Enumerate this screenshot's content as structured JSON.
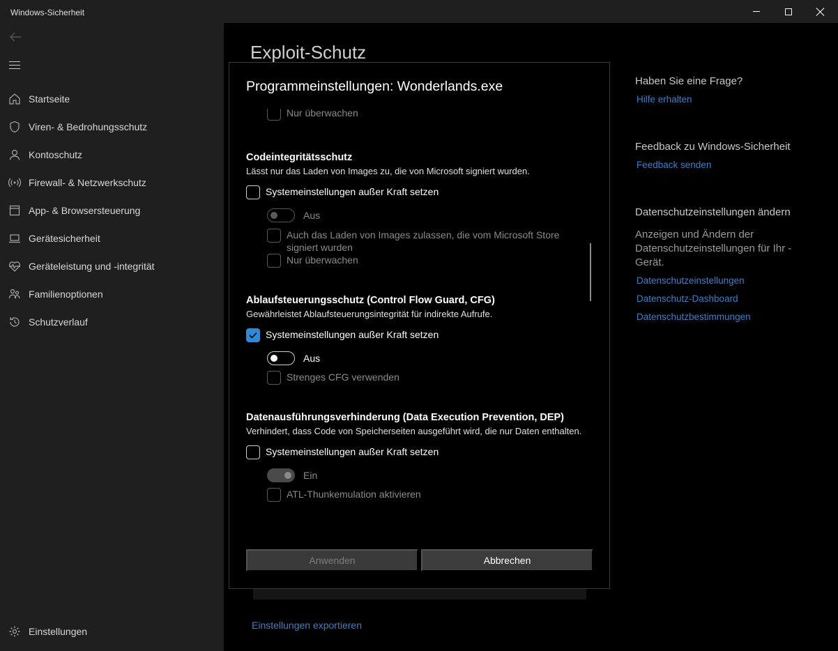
{
  "window": {
    "title": "Windows-Sicherheit"
  },
  "sidebar": {
    "items": [
      {
        "label": "Startseite",
        "icon": "home-icon"
      },
      {
        "label": "Viren- & Bedrohungsschutz",
        "icon": "shield-icon"
      },
      {
        "label": "Kontoschutz",
        "icon": "person-icon"
      },
      {
        "label": "Firewall- & Netzwerkschutz",
        "icon": "wifi-icon"
      },
      {
        "label": "App- & Browsersteuerung",
        "icon": "app-window-icon"
      },
      {
        "label": "Gerätesicherheit",
        "icon": "laptop-icon"
      },
      {
        "label": "Geräteleistung und -integrität",
        "icon": "heart-pulse-icon"
      },
      {
        "label": "Familienoptionen",
        "icon": "family-icon"
      },
      {
        "label": "Schutzverlauf",
        "icon": "history-icon"
      }
    ],
    "settings_label": "Einstellungen"
  },
  "main": {
    "page_title": "Exploit-Schutz",
    "export_link": "Einstellungen exportieren"
  },
  "right_panel": {
    "question_head": "Haben Sie eine Frage?",
    "help_link": "Hilfe erhalten",
    "feedback_head": "Feedback zu Windows-Sicherheit",
    "feedback_link": "Feedback senden",
    "privacy_head": "Datenschutzeinstellungen ändern",
    "privacy_text": "Anzeigen und Ändern der Datenschutzeinstellungen für Ihr -Gerät.",
    "privacy_links": [
      "Datenschutzeinstellungen",
      "Datenschutz-Dashboard",
      "Datenschutzbestimmungen"
    ]
  },
  "dialog": {
    "title": "Programmeinstellungen: Wonderlands.exe",
    "top_partial_label": "Nur überwachen",
    "sections": [
      {
        "title": "Codeintegritätsschutz",
        "description": "Lässt nur das Laden von Images zu, die von Microsoft signiert wurden.",
        "override_label": "Systemeinstellungen außer Kraft setzen",
        "override_checked": false,
        "toggle_label": "Aus",
        "toggle_on": false,
        "options": [
          "Auch das Laden von Images zulassen, die vom Microsoft Store signiert wurden",
          "Nur überwachen"
        ]
      },
      {
        "title": "Ablaufsteuerungsschutz (Control Flow Guard, CFG)",
        "description": "Gewährleistet Ablaufsteuerungsintegrität für indirekte Aufrufe.",
        "override_label": "Systemeinstellungen außer Kraft setzen",
        "override_checked": true,
        "toggle_label": "Aus",
        "toggle_on": false,
        "options": [
          "Strenges CFG verwenden"
        ]
      },
      {
        "title": "Datenausführungsverhinderung (Data Execution Prevention, DEP)",
        "description": "Verhindert, dass Code von Speicherseiten ausgeführt wird, die nur Daten enthalten.",
        "override_label": "Systemeinstellungen außer Kraft setzen",
        "override_checked": false,
        "toggle_label": "Ein",
        "toggle_on": true,
        "options": [
          "ATL-Thunkemulation aktivieren"
        ]
      }
    ],
    "apply_label": "Anwenden",
    "cancel_label": "Abbrechen"
  },
  "colors": {
    "accent": "#2e8ad8",
    "link": "#3f7fc6"
  }
}
